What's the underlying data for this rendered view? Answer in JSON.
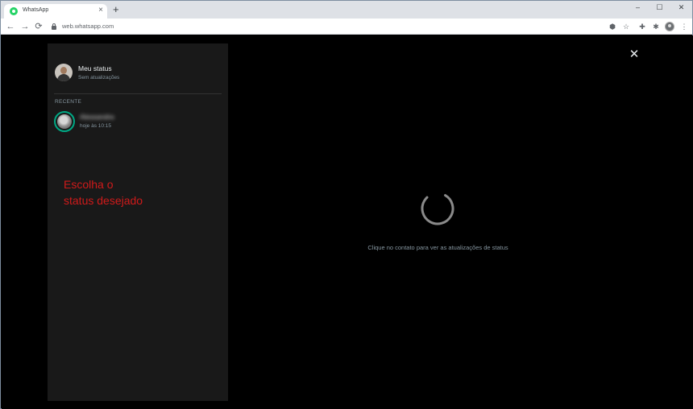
{
  "browser": {
    "tab_title": "WhatsApp",
    "tab_close": "×",
    "new_tab": "+",
    "window_controls": [
      "–",
      "☐",
      "✕"
    ],
    "nav": {
      "back": "←",
      "forward": "→",
      "reload": "⟳"
    },
    "url": "web.whatsapp.com",
    "extensions": [
      "⬢",
      "☆",
      "✚",
      "✱"
    ],
    "menu": "⋮"
  },
  "status_panel": {
    "my_status": {
      "name": "Meu status",
      "subtitle": "Sem atualizações"
    },
    "recent_header": "RECENTE",
    "contacts": [
      {
        "name": "Alessandra",
        "time": "hoje às 10:15"
      }
    ],
    "annotation": "Escolha o\nstatus desejado"
  },
  "viewer": {
    "close": "✕",
    "hint": "Clique no contato para ver as atualizações de status"
  },
  "colors": {
    "accent": "#00a884",
    "annotation": "#d01a1a",
    "panel_bg": "#191919",
    "page_bg": "#000000"
  }
}
